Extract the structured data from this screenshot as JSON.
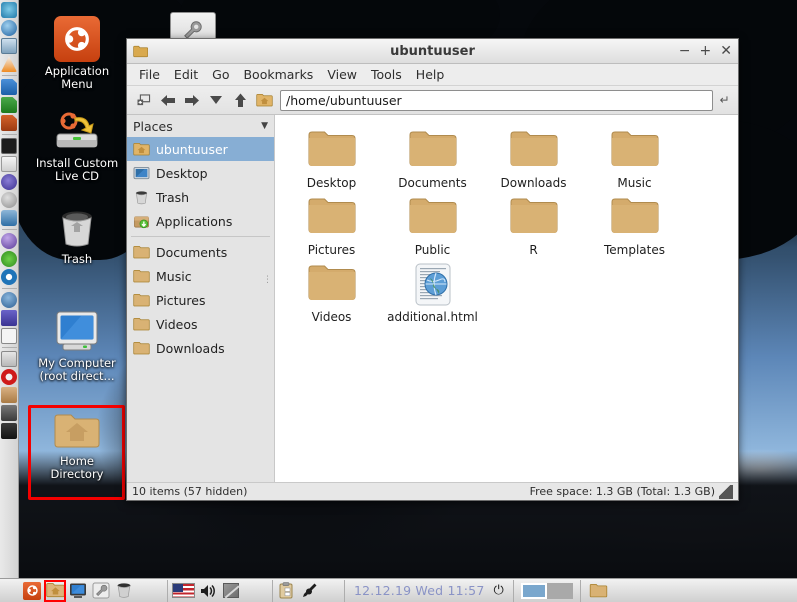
{
  "desktop": {
    "icons": [
      {
        "name": "application-menu",
        "label": "Application\nMenu",
        "icon": "ubuntu-logo-icon"
      },
      {
        "name": "install-custom-live-cd",
        "label": "Install Custom\nLive CD",
        "icon": "cd-install-icon"
      },
      {
        "name": "trash",
        "label": "Trash",
        "icon": "trash-icon"
      },
      {
        "name": "my-computer",
        "label": "My Computer\n(root direct...",
        "icon": "monitor-icon"
      },
      {
        "name": "home-directory",
        "label": "Home\nDirectory",
        "icon": "home-folder-icon"
      }
    ],
    "highlight_color": "#f40000"
  },
  "edge_launcher": {
    "items": [
      "browser-icon",
      "globe-icon",
      "screenshot-icon",
      "vlc-cone-icon",
      "writer-doc-icon",
      "calc-sheet-icon",
      "impress-slide-icon",
      "terminal-icon",
      "text-editor-icon",
      "blue-swirl-icon",
      "magnifier-icon",
      "gimp-icon",
      "purple-sphere-icon",
      "green-molecule-icon",
      "sync-arrows-icon",
      "help-circle-icon",
      "info-icon",
      "font-icon",
      "first-aid-icon",
      "forbidden-icon",
      "package-download-icon",
      "camera-icon",
      "audacity-icon"
    ]
  },
  "window": {
    "title": "ubuntuuser",
    "title_icon": "folder-icon",
    "controls": {
      "minimize": "−",
      "maximize": "+",
      "close": "✕"
    },
    "menu": [
      "File",
      "Edit",
      "Go",
      "Bookmarks",
      "View",
      "Tools",
      "Help"
    ],
    "toolbar": {
      "buttons": [
        {
          "name": "new-tab-icon",
          "glyph": "❐"
        },
        {
          "name": "back-icon",
          "glyph": "⬅"
        },
        {
          "name": "forward-icon",
          "glyph": "➡"
        },
        {
          "name": "history-dropdown-icon",
          "glyph": "▼"
        },
        {
          "name": "up-icon",
          "glyph": "⬆"
        },
        {
          "name": "home-icon",
          "glyph": "home-folder"
        }
      ],
      "path_value": "/home/ubuntuuser",
      "go_icon": "↵"
    },
    "sidebar": {
      "header": "Places",
      "header_caret": "▼",
      "items": [
        {
          "label": "ubuntuuser",
          "icon": "home-folder-icon",
          "selected": true
        },
        {
          "label": "Desktop",
          "icon": "desktop-icon",
          "selected": false
        },
        {
          "label": "Trash",
          "icon": "trash-icon",
          "selected": false
        },
        {
          "label": "Applications",
          "icon": "applications-icon",
          "selected": false
        },
        {
          "label": "Documents",
          "icon": "folder-icon",
          "selected": false
        },
        {
          "label": "Music",
          "icon": "folder-icon",
          "selected": false
        },
        {
          "label": "Pictures",
          "icon": "folder-icon",
          "selected": false
        },
        {
          "label": "Videos",
          "icon": "folder-icon",
          "selected": false
        },
        {
          "label": "Downloads",
          "icon": "folder-icon",
          "selected": false
        }
      ],
      "selected_color": "#87aed4"
    },
    "files": [
      {
        "name": "Desktop",
        "type": "folder"
      },
      {
        "name": "Documents",
        "type": "folder"
      },
      {
        "name": "Downloads",
        "type": "folder"
      },
      {
        "name": "Music",
        "type": "folder"
      },
      {
        "name": "Pictures",
        "type": "folder"
      },
      {
        "name": "Public",
        "type": "folder"
      },
      {
        "name": "R",
        "type": "folder"
      },
      {
        "name": "Templates",
        "type": "folder"
      },
      {
        "name": "Videos",
        "type": "folder"
      },
      {
        "name": "additional.html",
        "type": "html-document"
      }
    ],
    "status": {
      "left": "10 items (57 hidden)",
      "right": "Free space: 1.3 GB (Total: 1.3 GB)"
    }
  },
  "taskbar": {
    "launchers": [
      "ubuntu-logo-icon",
      "home-folder-icon",
      "monitor-icon",
      "wrench-icon",
      "trash-icon"
    ],
    "active_launcher_index": 1,
    "tray": [
      "us-flag-icon",
      "volume-icon",
      "display-icon"
    ],
    "tray2": [
      "clipboard-icon",
      "pen-icon"
    ],
    "clock": "12.12.19 Wed 11:57",
    "power_icon": "⏻",
    "workspaces": 2,
    "active_workspace": 0,
    "tasks": [
      "folder-icon"
    ]
  }
}
